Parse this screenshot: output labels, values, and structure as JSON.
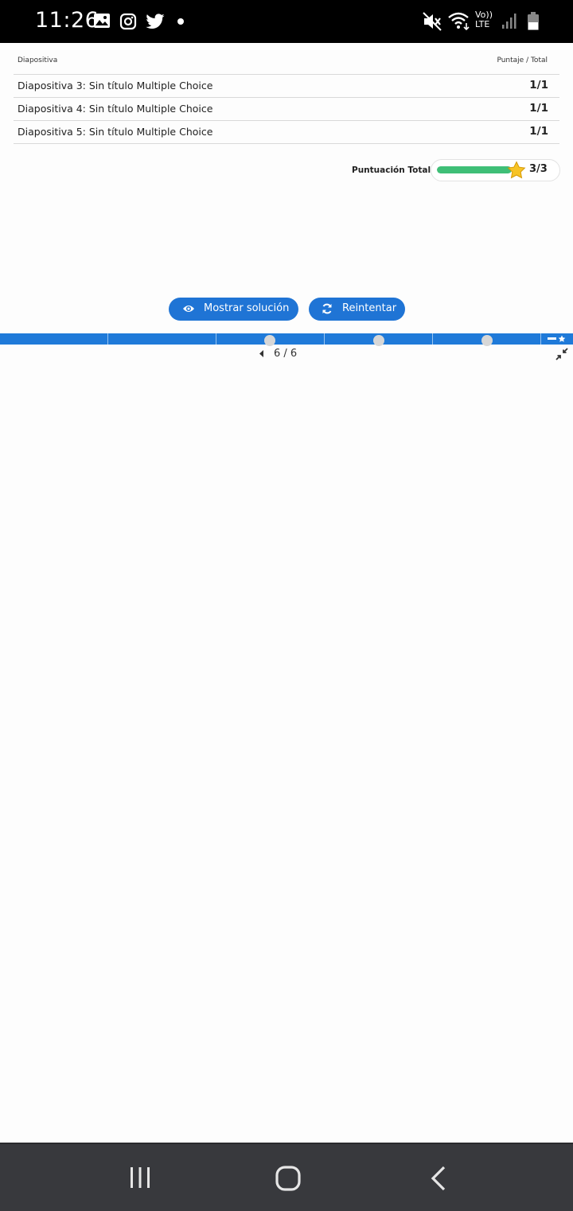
{
  "status_bar": {
    "time": "11:26",
    "notification_icons": [
      "gallery-icon",
      "instagram-icon",
      "twitter-icon",
      "dot-icon"
    ],
    "system_icons": [
      "mute-icon",
      "wifi-icon",
      "volte-icon",
      "signal-icon",
      "battery-icon"
    ],
    "volte_top": "Vo))",
    "volte_bottom": "LTE"
  },
  "results": {
    "header_slide": "Diapositiva",
    "header_score": "Puntaje / Total",
    "rows": [
      {
        "title": "Diapositiva 3: Sin título Multiple Choice",
        "score": "1/1"
      },
      {
        "title": "Diapositiva 4: Sin título Multiple Choice",
        "score": "1/1"
      },
      {
        "title": "Diapositiva 5: Sin título Multiple Choice",
        "score": "1/1"
      }
    ]
  },
  "total": {
    "label": "Puntuación Total",
    "value": "3/3",
    "progress_percent": 100
  },
  "actions": {
    "show_solution": "Mostrar solución",
    "retry": "Reintentar"
  },
  "pager": {
    "text": "6 / 6"
  },
  "colors": {
    "accent": "#1f74d5",
    "progress_fill": "#3fbf77",
    "star": "#f7c325"
  }
}
